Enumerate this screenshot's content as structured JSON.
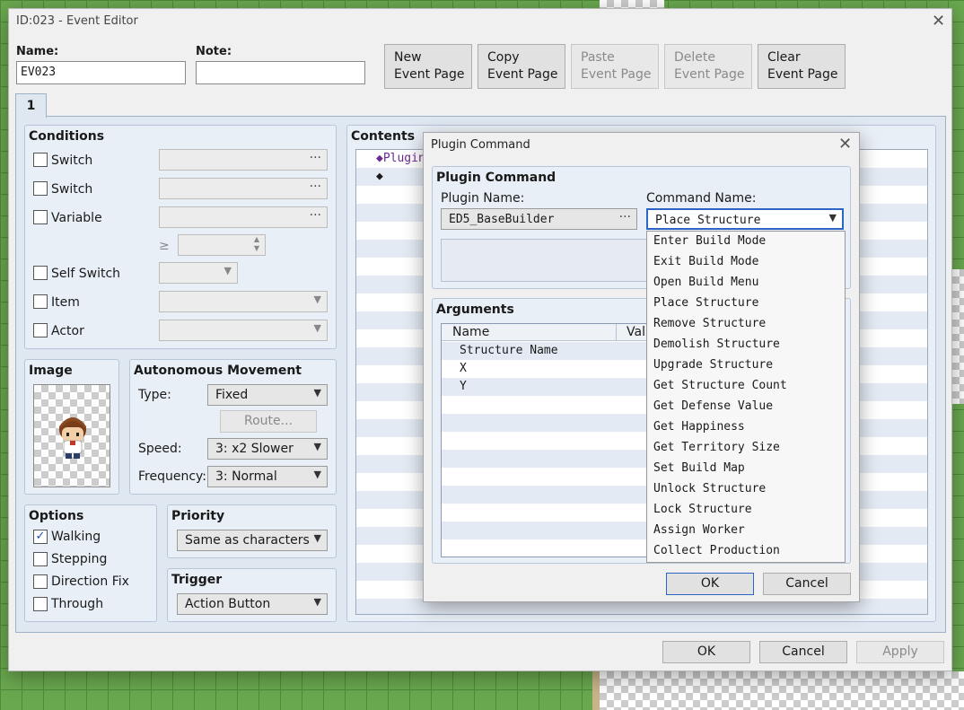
{
  "window": {
    "title": "ID:023 - Event Editor"
  },
  "header": {
    "name_label": "Name:",
    "name_value": "EV023",
    "note_label": "Note:",
    "note_value": "",
    "buttons": [
      {
        "line1": "New",
        "line2": "Event Page"
      },
      {
        "line1": "Copy",
        "line2": "Event Page"
      },
      {
        "line1": "Paste",
        "line2": "Event Page"
      },
      {
        "line1": "Delete",
        "line2": "Event Page"
      },
      {
        "line1": "Clear",
        "line2": "Event Page"
      }
    ]
  },
  "tabs": [
    "1"
  ],
  "conditions": {
    "title": "Conditions",
    "switch1": "Switch",
    "switch2": "Switch",
    "variable": "Variable",
    "ge": "≥",
    "self_switch": "Self Switch",
    "item": "Item",
    "actor": "Actor"
  },
  "image": {
    "title": "Image"
  },
  "movement": {
    "title": "Autonomous Movement",
    "type_label": "Type:",
    "type_value": "Fixed",
    "route": "Route...",
    "speed_label": "Speed:",
    "speed_value": "3: x2 Slower",
    "freq_label": "Frequency:",
    "freq_value": "3: Normal"
  },
  "options": {
    "title": "Options",
    "walking": "Walking",
    "stepping": "Stepping",
    "direction_fix": "Direction Fix",
    "through": "Through"
  },
  "priority": {
    "title": "Priority",
    "value": "Same as characters"
  },
  "trigger": {
    "title": "Trigger",
    "value": "Action Button"
  },
  "contents": {
    "title": "Contents",
    "line1": "◆Plugin",
    "line2": "◆"
  },
  "footer": {
    "ok": "OK",
    "cancel": "Cancel",
    "apply": "Apply"
  },
  "plugin_dialog": {
    "title": "Plugin Command",
    "group_title": "Plugin Command",
    "plugin_name_label": "Plugin Name:",
    "plugin_name_value": "ED5_BaseBuilder",
    "command_name_label": "Command Name:",
    "command_name_value": "Place Structure",
    "arguments_title": "Arguments",
    "col_name": "Name",
    "col_value": "Valu",
    "args": [
      "Structure Name",
      "X",
      "Y"
    ],
    "ok": "OK",
    "cancel": "Cancel",
    "command_options": [
      "Enter Build Mode",
      "Exit Build Mode",
      "Open Build Menu",
      "Place Structure",
      "Remove Structure",
      "Demolish Structure",
      "Upgrade Structure",
      "Get Structure Count",
      "Get Defense Value",
      "Get Happiness",
      "Get Territory Size",
      "Set Build Map",
      "Unlock Structure",
      "Lock Structure",
      "Assign Worker",
      "Collect Production"
    ]
  }
}
